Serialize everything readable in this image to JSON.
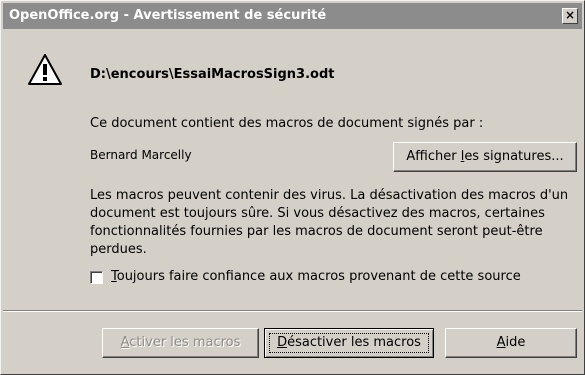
{
  "window": {
    "title": "OpenOffice.org - Avertissement de sécurité",
    "close_glyph": "×"
  },
  "icon": {
    "name": "warning-icon"
  },
  "document": {
    "path": "D:\\encours\\EssaiMacrosSign3.odt"
  },
  "content": {
    "info_line": "Ce document contient des macros de document signés par :",
    "signer": "Bernard Marcelly",
    "view_signatures": {
      "before": "Afficher ",
      "mnemonic": "l",
      "after": "es signatures..."
    },
    "warning_text": "Les macros peuvent contenir des virus. La désactivation des macros d'un document est toujours sûre. Si vous désactivez des macros, certaines fonctionnalités fournies par les macros de document seront peut-être perdues.",
    "trust_checkbox": {
      "mnemonic": "T",
      "label_rest": "oujours faire confiance aux macros provenant de cette source",
      "checked": false
    }
  },
  "buttons": {
    "activate": {
      "mnemonic": "A",
      "rest": "ctiver les macros",
      "enabled": false
    },
    "deactivate": {
      "mnemonic": "D",
      "rest": "ésactiver les macros",
      "default": true
    },
    "help": {
      "mnemonic": "A",
      "rest": "ide"
    }
  },
  "colors": {
    "dialog_bg": "#d4d0c8",
    "titlebar_bg": "#8c8c8c",
    "disabled_text": "#8f8c86"
  }
}
